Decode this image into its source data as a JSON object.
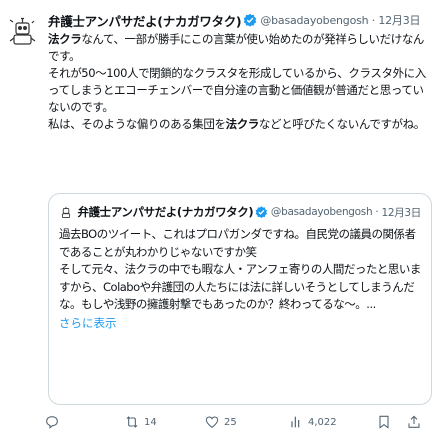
{
  "author": {
    "name": "弁護士アンパサだよ(ナカガワタク)",
    "handle": "@basadayobengosh",
    "date": "12月3日"
  },
  "tweet": {
    "lines": [
      "法クラなんて、一部が勝手にこの言葉が使い始めたのが発祥らしいだけなんです。",
      "それが50〜100人で閉鎖的なクラスタを形成しているから、クラスタ外に入ってしまうとエコーチェンバーで自分達の言動と価値観が普通だと思っていないのです。",
      "私は、そのような偏りのある集団を法クラなどと呼びたくないんですがね。"
    ],
    "bold_word": "法クラ"
  },
  "quote": {
    "name": "弁護士アンパサだよ(ナカガワタク)",
    "handle": "@basadayobengosh",
    "date": "12月3日",
    "lines": [
      "過去BOのツイート、これはプロパガンダですね。自民党の議員の関係者であることが丸わかりじゃないですか笑",
      "そして元々、法クラの中でも暇な人・アンフェ寄りの人間だったと思いますから、Colaboや弁護団の人たちには法に詳しいそうとしてしまうんだな。もしや浅野の擁護射撃でもあったのか？終わってるな〜。..."
    ],
    "show_more": "さらに表示"
  },
  "actions": {
    "reply_count": "",
    "retweet_count": "14",
    "like_count": "25",
    "views_count": "4,022"
  },
  "colors": {
    "link": "#1d9bf0",
    "verified": "#1d9bf0",
    "muted": "#536471",
    "border": "#cfd9de"
  }
}
